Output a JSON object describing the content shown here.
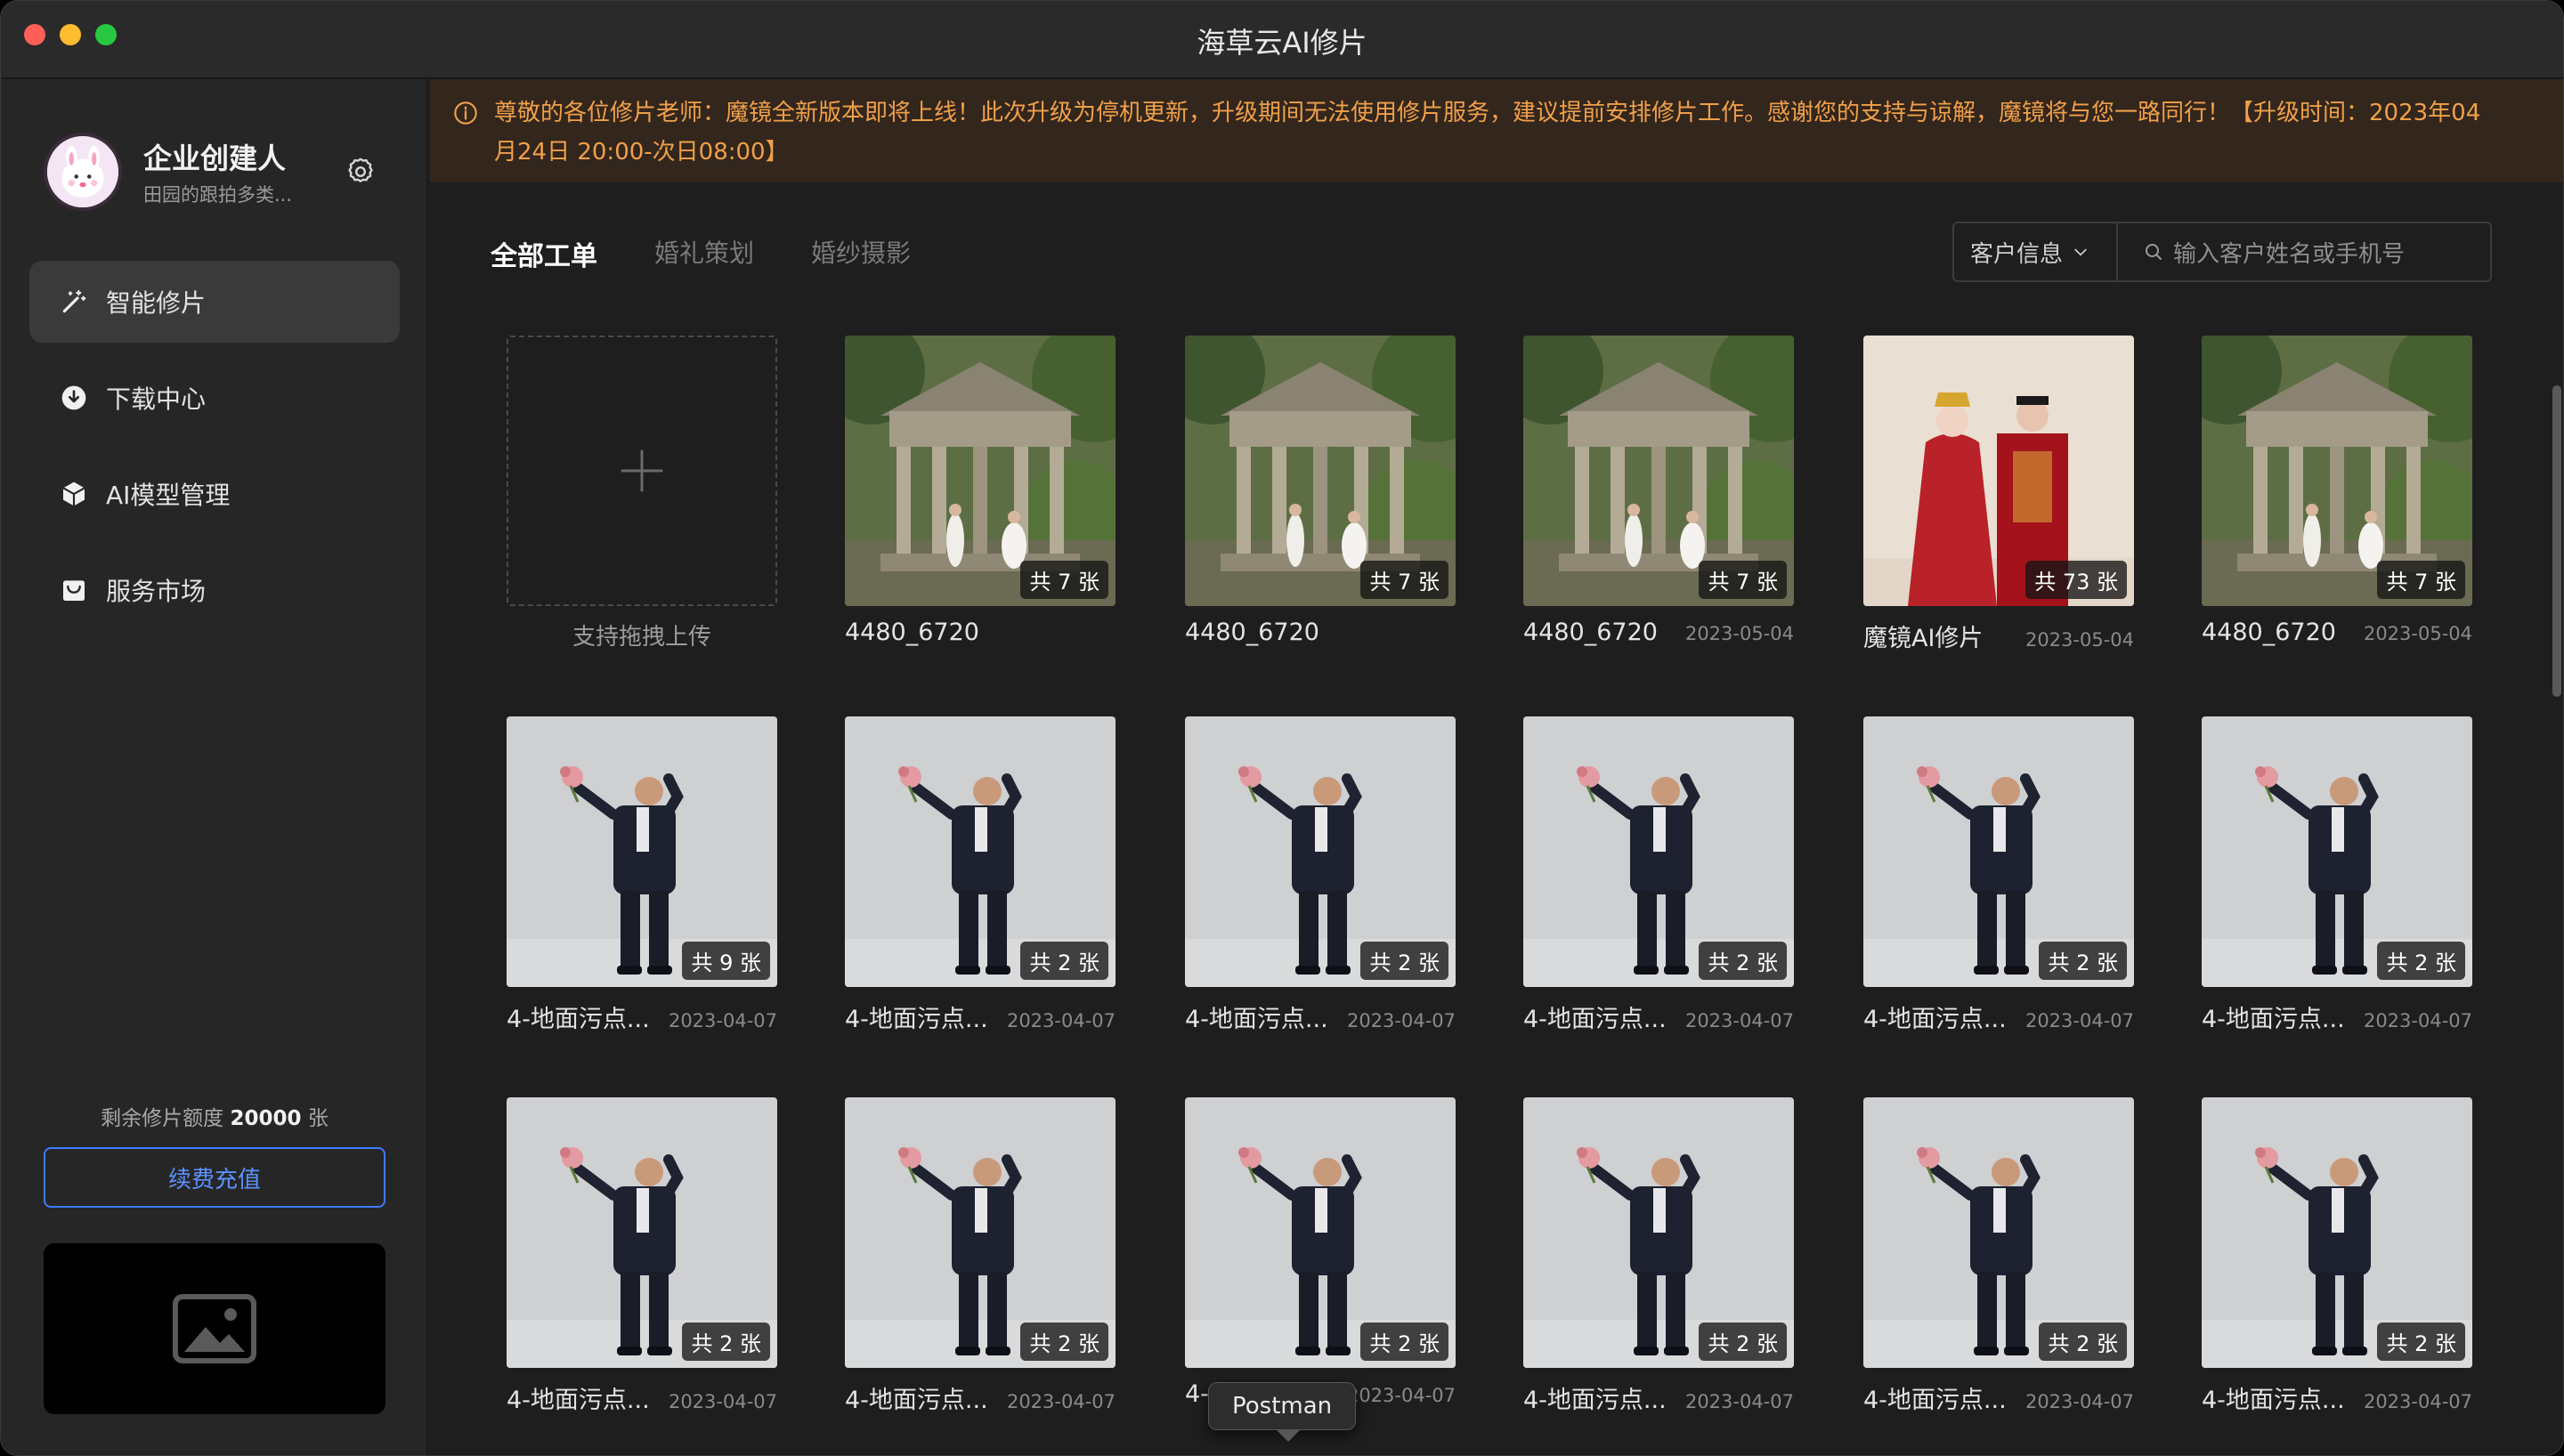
{
  "window": {
    "title": "海草云AI修片"
  },
  "user": {
    "name": "企业创建人",
    "subtitle": "田园的跟拍多类..."
  },
  "nav": [
    {
      "label": "智能修片",
      "icon": "magic-wand-icon",
      "active": true
    },
    {
      "label": "下载中心",
      "icon": "download-icon",
      "active": false
    },
    {
      "label": "AI模型管理",
      "icon": "cube-icon",
      "active": false
    },
    {
      "label": "服务市场",
      "icon": "store-icon",
      "active": false
    }
  ],
  "quota": {
    "prefix": "剩余修片额度",
    "value": "20000",
    "unit": "张"
  },
  "recharge_label": "续费充值",
  "notice": "尊敬的各位修片老师：魔镜全新版本即将上线！此次升级为停机更新，升级期间无法使用修片服务，建议提前安排修片工作。感谢您的支持与谅解，魔镜将与您一路同行！【升级时间：2023年04月24日 20:00-次日08:00】",
  "tabs": [
    {
      "label": "全部工单",
      "active": true
    },
    {
      "label": "婚礼策划",
      "active": false
    },
    {
      "label": "婚纱摄影",
      "active": false
    }
  ],
  "filter": {
    "select": "客户信息",
    "placeholder": "输入客户姓名或手机号"
  },
  "upload_label": "支持拖拽上传",
  "rows": [
    [
      {
        "name": "4480_6720",
        "date": "",
        "count": "共 7 张",
        "img": "pavilion"
      },
      {
        "name": "4480_6720",
        "date": "",
        "count": "共 7 张",
        "img": "pavilion"
      },
      {
        "name": "4480_6720",
        "date": "2023-05-04",
        "count": "共 7 张",
        "img": "pavilion"
      },
      {
        "name": "魔镜AI修片",
        "date": "2023-05-04",
        "count": "共 73 张",
        "img": "couple"
      },
      {
        "name": "4480_6720",
        "date": "2023-05-04",
        "count": "共 7 张",
        "img": "pavilion"
      }
    ],
    [
      {
        "name": "4-地面污点...",
        "date": "2023-04-07",
        "count": "共 9 张",
        "img": "groom"
      },
      {
        "name": "4-地面污点...",
        "date": "2023-04-07",
        "count": "共 2 张",
        "img": "groom"
      },
      {
        "name": "4-地面污点...",
        "date": "2023-04-07",
        "count": "共 2 张",
        "img": "groom"
      },
      {
        "name": "4-地面污点...",
        "date": "2023-04-07",
        "count": "共 2 张",
        "img": "groom"
      },
      {
        "name": "4-地面污点...",
        "date": "2023-04-07",
        "count": "共 2 张",
        "img": "groom"
      },
      {
        "name": "4-地面污点...",
        "date": "2023-04-07",
        "count": "共 2 张",
        "img": "groom"
      }
    ],
    [
      {
        "name": "4-地面污点...",
        "date": "2023-04-07",
        "count": "共 2 张",
        "img": "groom"
      },
      {
        "name": "4-地面污点...",
        "date": "2023-04-07",
        "count": "共 2 张",
        "img": "groom"
      },
      {
        "name": "4-",
        "date": "2023-04-07",
        "count": "共 2 张",
        "img": "groom"
      },
      {
        "name": "4-地面污点...",
        "date": "2023-04-07",
        "count": "共 2 张",
        "img": "groom"
      },
      {
        "name": "4-地面污点...",
        "date": "2023-04-07",
        "count": "共 2 张",
        "img": "groom"
      },
      {
        "name": "4-地面污点...",
        "date": "2023-04-07",
        "count": "共 2 张",
        "img": "groom"
      }
    ]
  ],
  "tooltip": "Postman"
}
